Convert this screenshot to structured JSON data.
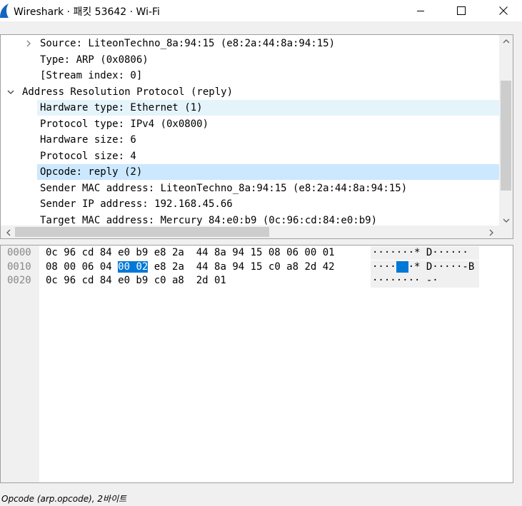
{
  "window": {
    "title": "Wireshark · 패킷 53642 · Wi-Fi",
    "icon": "wireshark-fin-icon",
    "controls": [
      "minimize-icon",
      "maximize-icon",
      "close-icon"
    ]
  },
  "tree": {
    "rows": [
      {
        "text": "Source: LiteonTechno_8a:94:15 (e8:2a:44:8a:94:15)",
        "expander": "collapsed",
        "highlight": "none"
      },
      {
        "text": "Type: ARP (0x0806)",
        "expander": "none",
        "highlight": "none"
      },
      {
        "text": "[Stream index: 0]",
        "expander": "none",
        "highlight": "none"
      },
      {
        "text": "Address Resolution Protocol (reply)",
        "expander": "expanded",
        "highlight": "none"
      },
      {
        "text": "Hardware type: Ethernet (1)",
        "expander": "none",
        "highlight": "hover"
      },
      {
        "text": "Protocol type: IPv4 (0x0800)",
        "expander": "none",
        "highlight": "none"
      },
      {
        "text": "Hardware size: 6",
        "expander": "none",
        "highlight": "none"
      },
      {
        "text": "Protocol size: 4",
        "expander": "none",
        "highlight": "none"
      },
      {
        "text": "Opcode: reply (2)",
        "expander": "none",
        "highlight": "selected"
      },
      {
        "text": "Sender MAC address: LiteonTechno_8a:94:15 (e8:2a:44:8a:94:15)",
        "expander": "none",
        "highlight": "none"
      },
      {
        "text": "Sender IP address: 192.168.45.66",
        "expander": "none",
        "highlight": "none"
      },
      {
        "text": "Target MAC address: Mercury_84:e0:b9 (0c:96:cd:84:e0:b9)",
        "expander": "none",
        "highlight": "none"
      }
    ]
  },
  "hex": {
    "lines": [
      {
        "offset": "0000",
        "before": "0c 96 cd 84 e0 b9 e8 2a  44 8a 94 15 08 06 00 01",
        "sel": "",
        "after": "",
        "ascii_before": "·······* D······",
        "ascii_sel": "",
        "ascii_after": ""
      },
      {
        "offset": "0010",
        "before": "08 00 06 04 ",
        "sel": "00 02",
        "after": " e8 2a  44 8a 94 15 c0 a8 2d 42",
        "ascii_before": "····",
        "ascii_sel": "··",
        "ascii_after": "·* D·····-B"
      },
      {
        "offset": "0020",
        "before": "0c 96 cd 84 e0 b9 c0 a8  2d 01",
        "sel": "",
        "after": "",
        "ascii_before": "········ -·",
        "ascii_sel": "",
        "ascii_after": ""
      }
    ]
  },
  "status": {
    "text": "Opcode (arp.opcode), 2바이트"
  },
  "colors": {
    "hover_highlight": "#e5f3fb",
    "selected_highlight": "#cce8ff",
    "hex_selection": "#0078d7",
    "border": "#a0a0a0",
    "offset_text": "#888888"
  }
}
